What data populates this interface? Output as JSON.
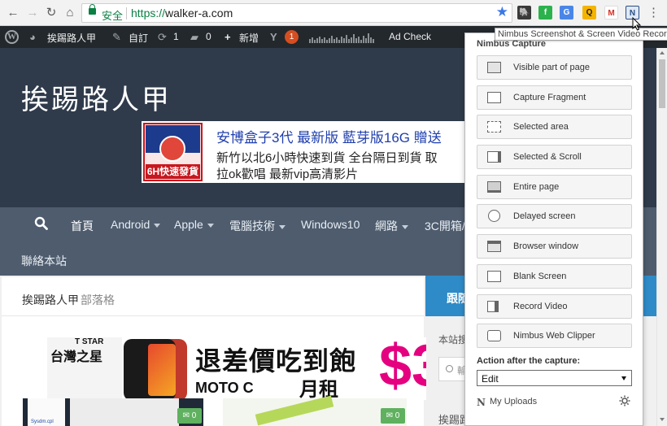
{
  "browser": {
    "secure_label": "安全",
    "url_scheme": "https://",
    "url_host": "walker-a.com",
    "back_icon": "←",
    "forward_icon": "→",
    "reload_icon": "↻",
    "home_icon": "⌂",
    "star_icon": "★",
    "menu_icon": "⋮",
    "extensions": [
      {
        "name": "evernote-icon",
        "glyph": "🐘",
        "color": "#3a3a3a"
      },
      {
        "name": "feedly-icon",
        "glyph": "f",
        "color": "#2bb24c"
      },
      {
        "name": "google-translate-icon",
        "glyph": "G",
        "color": "#4a86e8"
      },
      {
        "name": "qr-icon",
        "glyph": "Q",
        "color": "#f5b400"
      },
      {
        "name": "gmail-icon",
        "glyph": "M",
        "color": "#d93025"
      },
      {
        "name": "nimbus-icon",
        "glyph": "N",
        "color": "#4a6fa5"
      }
    ]
  },
  "tooltip": {
    "text": "Nimbus Screenshot & Screen Video Recorder"
  },
  "wp_bar": {
    "site_name": "挨踢路人甲",
    "customize": "自訂",
    "updates_count": "1",
    "comments_count": "0",
    "new_label": "新增",
    "yoast_badge": "1",
    "ad_check": "Ad Check"
  },
  "header": {
    "site_title": "挨踢路人甲",
    "ad": {
      "box_top": "安博盒子3代",
      "box_bottom": "6H快速發貨",
      "line1": "安博盒子3代 最新版 藍芽版16G 贈送",
      "line2": "新竹以北6小時快速到貨 全台隔日到貨 取",
      "line3": "拉ok歡唱 最新vip高清影片"
    }
  },
  "nav": {
    "items": [
      {
        "label": "首頁",
        "active": true
      },
      {
        "label": "Android",
        "dropdown": true
      },
      {
        "label": "Apple",
        "dropdown": true
      },
      {
        "label": "電腦技術",
        "dropdown": true
      },
      {
        "label": "Windows10",
        "dropdown": false
      },
      {
        "label": "網路",
        "dropdown": true
      },
      {
        "label": "3C開箱/",
        "dropdown": false
      }
    ],
    "second_row": "聯絡本站"
  },
  "content": {
    "blog_title": "挨踢路人甲",
    "blog_subtitle": "部落格",
    "promo": {
      "brand_small": "T STAR",
      "brand": "台灣之星",
      "title": "退差價吃到飽",
      "model": "MOTO C",
      "rent": "月租",
      "price": "$3"
    },
    "thumb1_file": "Sysdm.cpl",
    "comment_counts": [
      "0",
      "0"
    ],
    "sidebar": {
      "tab": "跟隨",
      "label": "本站搜",
      "search_placeholder": "輸",
      "footer": "挨踢路"
    }
  },
  "nimbus": {
    "title": "Nimbus Capture",
    "buttons": [
      {
        "label": "Visible part of page",
        "icon": "visible-page-icon"
      },
      {
        "label": "Capture Fragment",
        "icon": "fragment-icon"
      },
      {
        "label": "Selected area",
        "icon": "selected-area-icon"
      },
      {
        "label": "Selected & Scroll",
        "icon": "selected-scroll-icon"
      },
      {
        "label": "Entire page",
        "icon": "entire-page-icon"
      },
      {
        "label": "Delayed screen",
        "icon": "timer-icon"
      },
      {
        "label": "Browser window",
        "icon": "browser-window-icon"
      },
      {
        "label": "Blank Screen",
        "icon": "blank-screen-icon"
      },
      {
        "label": "Record Video",
        "icon": "video-camera-icon"
      },
      {
        "label": "Nimbus Web Clipper",
        "icon": "camera-icon"
      }
    ],
    "after_label": "Action after the capture:",
    "after_value": "Edit",
    "uploads_label": "My Uploads"
  }
}
